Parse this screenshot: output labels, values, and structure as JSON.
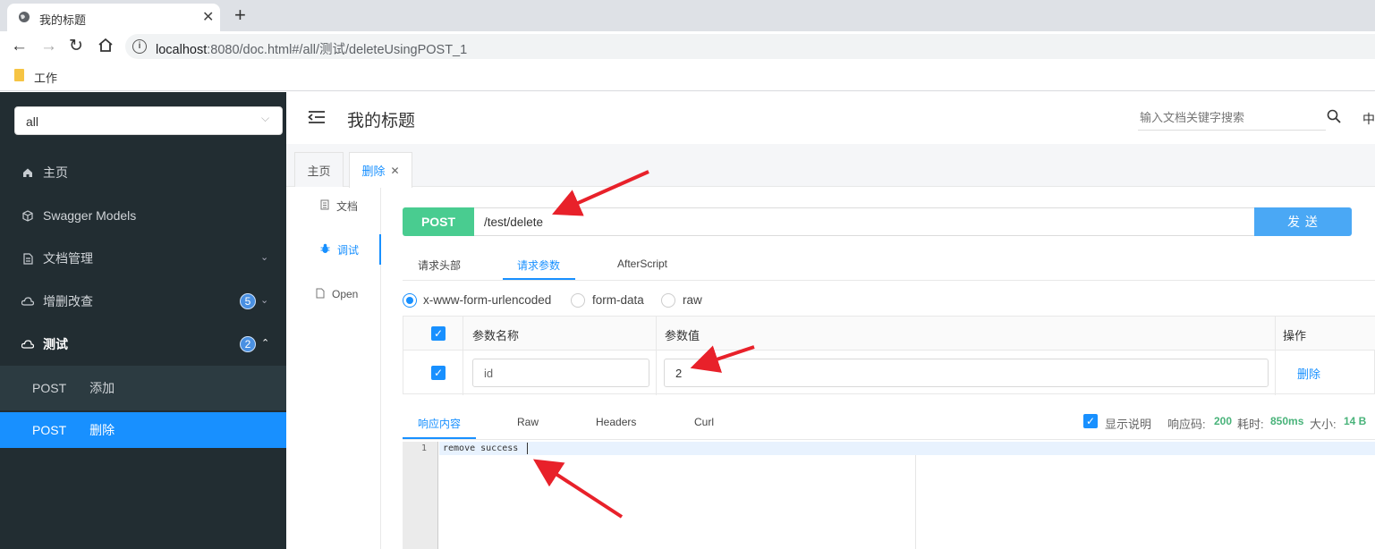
{
  "browser": {
    "tab_title": "我的标题",
    "url_host": "localhost",
    "url_rest": ":8080/doc.html#/all/测试/deleteUsingPOST_1",
    "bookmark": "工作"
  },
  "sidebar": {
    "group_select": "all",
    "items": [
      {
        "label": "主页"
      },
      {
        "label": "Swagger Models"
      },
      {
        "label": "文档管理"
      },
      {
        "label": "增删改查",
        "badge": "5"
      },
      {
        "label": "测试",
        "badge": "2"
      }
    ],
    "sub_items": [
      {
        "method": "POST",
        "label": "添加"
      },
      {
        "method": "POST",
        "label": "删除"
      }
    ]
  },
  "header": {
    "title": "我的标题",
    "search_placeholder": "输入文档关键字搜索",
    "lang": "中"
  },
  "tabs": [
    {
      "label": "主页"
    },
    {
      "label": "删除"
    }
  ],
  "sub_nav": [
    {
      "label": "文档"
    },
    {
      "label": "调试"
    },
    {
      "label": "Open"
    }
  ],
  "request": {
    "method": "POST",
    "url": "/test/delete",
    "send_label": "发 送",
    "tabs": [
      "请求头部",
      "请求参数",
      "AfterScript"
    ],
    "content_types": [
      "x-www-form-urlencoded",
      "form-data",
      "raw"
    ],
    "table_headers": [
      "参数名称",
      "参数值",
      "操作"
    ],
    "params": [
      {
        "name": "id",
        "value": "2",
        "action": "删除"
      }
    ]
  },
  "response": {
    "tabs": [
      "响应内容",
      "Raw",
      "Headers",
      "Curl"
    ],
    "show_desc_label": "显示说明",
    "code_label": "响应码:",
    "code": "200",
    "time_label": "耗时:",
    "time": "850ms",
    "size_label": "大小:",
    "size": "14 B",
    "line_number": "1",
    "body": "remove success"
  },
  "colors": {
    "sidebar_bg": "#222d32",
    "active_blue": "#1890ff",
    "post_green": "#49cc90",
    "send_blue": "#4aa8f5",
    "annotation_red": "#e8212a"
  }
}
